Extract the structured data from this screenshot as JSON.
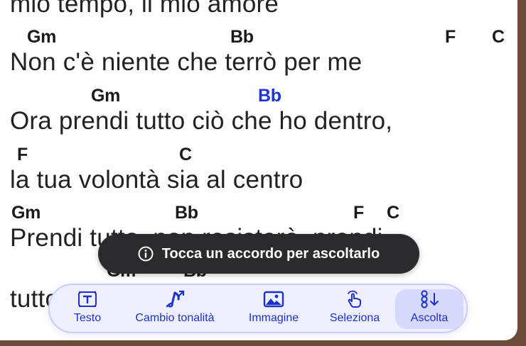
{
  "lyrics": {
    "partial_top": "mio tempo, il mio amore",
    "lines": [
      {
        "chords": [
          "Gm",
          "Bb",
          "F",
          "C"
        ],
        "text": "Non c'è niente che terrò per me"
      },
      {
        "chords": [
          "Gm",
          "Bb"
        ],
        "text": "Ora prendi tutto ciò che ho dentro,"
      },
      {
        "chords": [
          "F",
          "C"
        ],
        "text": "la tua volontà sia al centro"
      },
      {
        "chords": [
          "Gm",
          "Bb",
          "F",
          "C"
        ],
        "text": "Prendi tutto, non resisterò, prendi"
      },
      {
        "chords": [
          "Gm",
          "Bb"
        ],
        "text": "tutto"
      }
    ]
  },
  "active_chord": "Bb",
  "active_chord_color": "#1e33d9",
  "toast": {
    "message": "Tocca un accordo per ascoltarlo",
    "icon": "info-icon"
  },
  "toolbar": {
    "items": [
      {
        "label": "Testo",
        "icon": "text-box-icon"
      },
      {
        "label": "Cambio tonalità",
        "icon": "transpose-icon"
      },
      {
        "label": "Immagine",
        "icon": "image-icon"
      },
      {
        "label": "Seleziona",
        "icon": "tap-hand-icon"
      },
      {
        "label": "Ascolta",
        "icon": "listen-note-icon"
      }
    ],
    "selected": "Ascolta",
    "accent_color": "#1c31c8"
  }
}
